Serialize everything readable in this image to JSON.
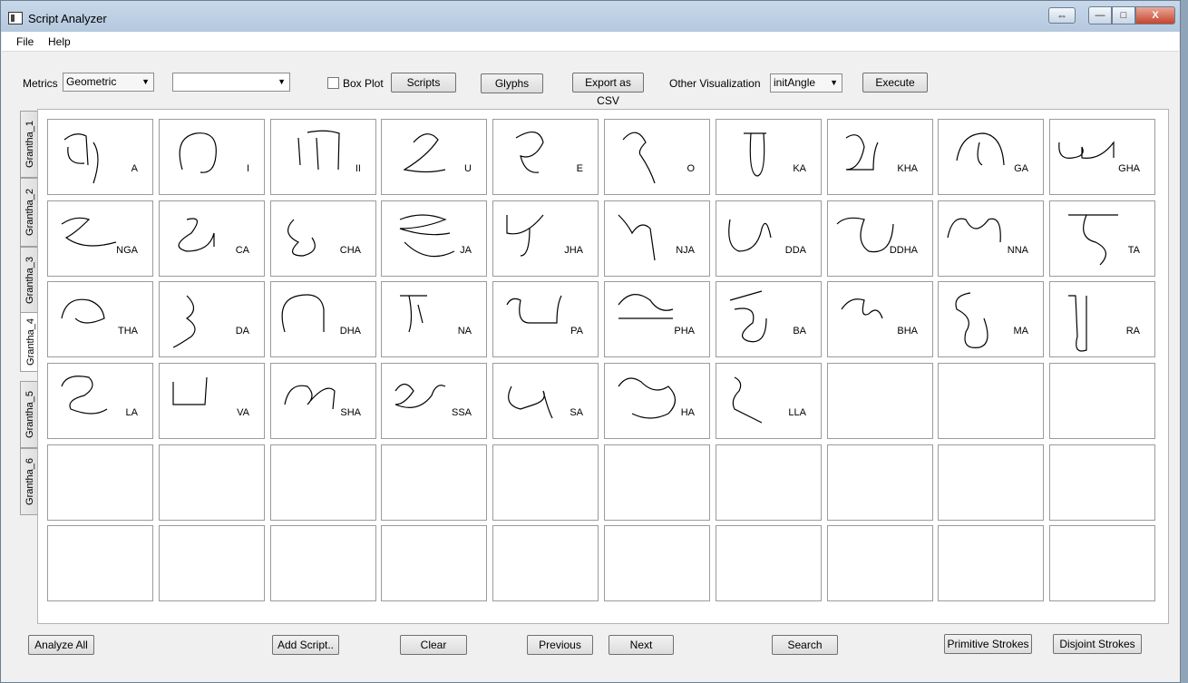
{
  "window": {
    "title": "Script Analyzer"
  },
  "caption": {
    "snap": "⇔",
    "min": "—",
    "max": "□",
    "close": "X"
  },
  "menu": {
    "file": "File",
    "help": "Help"
  },
  "toolbar": {
    "metrics_label": "Metrics",
    "metrics_value": "Geometric",
    "second_combo_value": "",
    "boxplot_label": "Box Plot",
    "scripts_btn": "Scripts",
    "glyphs_btn": "Glyphs",
    "export_btn": "Export as CSV",
    "other_vis_label": "Other Visualization",
    "other_vis_value": "initAngle",
    "execute_btn": "Execute"
  },
  "tabs": [
    "Grantha_1",
    "Grantha_2",
    "Grantha_3",
    "Grantha_4",
    "Grantha_5",
    "Grantha_6"
  ],
  "active_tab": "Grantha_4",
  "glyph_labels": [
    "A",
    "I",
    "II",
    "U",
    "E",
    "O",
    "KA",
    "KHA",
    "GA",
    "GHA",
    "NGA",
    "CA",
    "CHA",
    "JA",
    "JHA",
    "NJA",
    "DDA",
    "DDHA",
    "NNA",
    "TA",
    "THA",
    "DA",
    "DHA",
    "NA",
    "PA",
    "PHA",
    "BA",
    "BHA",
    "MA",
    "RA",
    "LA",
    "VA",
    "SHA",
    "SSA",
    "SA",
    "HA",
    "LLA"
  ],
  "footer": {
    "analyze_all": "Analyze All",
    "add_script": "Add Script..",
    "clear": "Clear",
    "previous": "Previous",
    "next": "Next",
    "search": "Search",
    "primitive_strokes": "Primitive Strokes",
    "disjoint_strokes": "Disjoint Strokes"
  }
}
